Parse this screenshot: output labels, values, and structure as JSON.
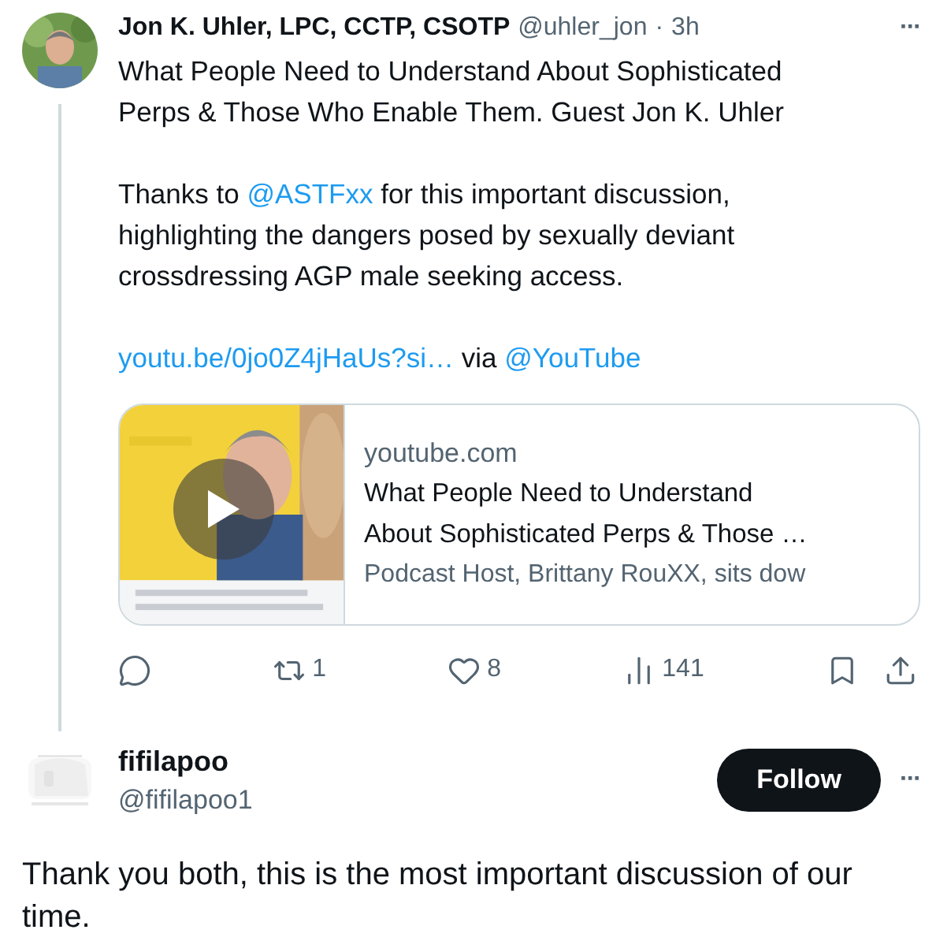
{
  "post": {
    "author_name": "Jon K. Uhler, LPC, CCTP, CSOTP",
    "handle": "@uhler_jon",
    "separator": "·",
    "time": "3h",
    "more": "···",
    "paragraphs": [
      [
        [
          {
            "kind": "text",
            "text": "What People Need to Understand About Sophisticated"
          }
        ],
        [
          {
            "kind": "text",
            "text": "Perps & Those Who Enable Them. Guest Jon K. Uhler"
          }
        ]
      ],
      [
        [
          {
            "kind": "text",
            "text": "Thanks to "
          },
          {
            "kind": "link",
            "text": "@ASTFxx"
          },
          {
            "kind": "text",
            "text": " for this important discussion,"
          }
        ],
        [
          {
            "kind": "text",
            "text": "highlighting the dangers posed by sexually deviant"
          }
        ],
        [
          {
            "kind": "text",
            "text": "crossdressing AGP male seeking access."
          }
        ]
      ],
      [
        [
          {
            "kind": "link",
            "text": "youtu.be/0jo0Z4jHaUs?si…"
          },
          {
            "kind": "text",
            "text": " via "
          },
          {
            "kind": "link",
            "text": "@YouTube"
          }
        ]
      ]
    ],
    "card": {
      "thumbnail": {
        "kind": "picture"
      },
      "domain": "youtube.com",
      "title_lines": [
        "What People Need to Understand",
        "About Sophisticated Perps & Those …"
      ],
      "description": "Podcast Host, Brittany RouXX, sits dow"
    },
    "actions": [
      {
        "kind": "reply"
      },
      {
        "kind": "repost",
        "count": "1"
      },
      {
        "kind": "like",
        "count": "8"
      },
      {
        "kind": "views",
        "count": "141"
      },
      {
        "kind": "bookmark"
      },
      {
        "kind": "share"
      }
    ]
  },
  "reply": {
    "author_name": "fifilapoo",
    "handle": "@fifilapoo1",
    "follow_button": "Follow",
    "more": "···",
    "text": "Thank you both, this is the most important discussion of our time."
  }
}
